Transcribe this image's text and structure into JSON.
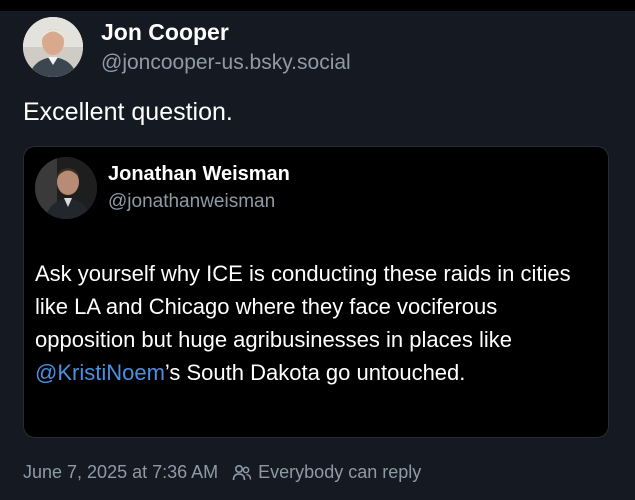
{
  "post": {
    "author": {
      "display_name": "Jon Cooper",
      "handle": "@joncooper-us.bsky.social",
      "avatar_icon": "person-avatar"
    },
    "text": "Excellent question.",
    "quote": {
      "author": {
        "display_name": "Jonathan Weisman",
        "handle": "@jonathanweisman",
        "avatar_icon": "person-avatar"
      },
      "text_before": "Ask yourself why ICE is conducting these raids in cities like LA and Chicago where they face vociferous opposition but huge agribusinesses in places like ",
      "mention": "@KristiNoem",
      "text_after": "’s South Dakota go untouched."
    },
    "timestamp": "June 7, 2025 at 7:36 AM",
    "reply_setting_icon": "people-icon",
    "reply_setting": "Everybody can reply"
  },
  "colors": {
    "background": "#151a22",
    "quote_background": "#000000",
    "muted_text": "#8f9aa7",
    "mention_link": "#4a90e2"
  }
}
